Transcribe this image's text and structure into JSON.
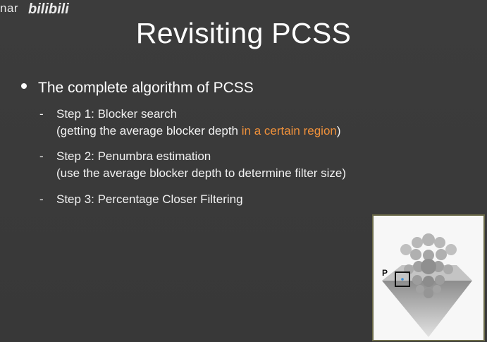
{
  "watermark": {
    "text": "nar",
    "logo_text": "bilibili"
  },
  "slide": {
    "title": "Revisiting PCSS",
    "bullet": "The complete algorithm of PCSS",
    "steps": [
      {
        "dash": "-",
        "line1": "Step 1: Blocker search",
        "line2_pre": "(getting the average blocker depth ",
        "line2_highlight": "in a certain region",
        "line2_post": ")"
      },
      {
        "dash": "-",
        "line1": "Step 2: Penumbra estimation",
        "line2": "(use the average blocker depth to determine filter size)"
      },
      {
        "dash": "-",
        "line1": "Step 3: Percentage Closer Filtering"
      }
    ],
    "figure": {
      "label": "P"
    }
  },
  "colors": {
    "background": "#3a3a3a",
    "text": "#ffffff",
    "highlight": "#f0913a",
    "figure_border": "#6b6a49"
  }
}
